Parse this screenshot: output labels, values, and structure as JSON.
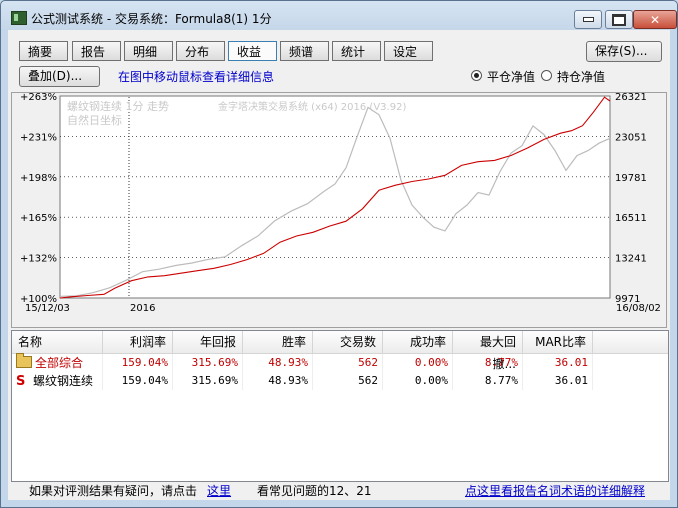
{
  "window": {
    "title": "公式测试系统 - 交易系统：Formula8(1) 1分"
  },
  "toolbar": {
    "tabs": [
      {
        "label": "摘要"
      },
      {
        "label": "报告"
      },
      {
        "label": "明细"
      },
      {
        "label": "分布"
      },
      {
        "label": "收益"
      },
      {
        "label": "频谱"
      },
      {
        "label": "统计"
      },
      {
        "label": "设定"
      }
    ],
    "active_tab": "收益",
    "save_label": "保存(S)...",
    "overlay_label": "叠加(D)...",
    "hint_link": "在图中移动鼠标查看详细信息",
    "radio_flat": "平仓净值",
    "radio_hold": "持仓净值"
  },
  "chart_data": {
    "type": "line",
    "overlay_text": {
      "instrument": "螺纹钢连续 1分 走势",
      "axis_note": "自然日坐标",
      "system_caption": "金字塔决策交易系统 (x64) 2016 (V3.92)"
    },
    "left_ticks": [
      "+263%",
      "+231%",
      "+198%",
      "+165%",
      "+132%",
      "+100%"
    ],
    "right_ticks": [
      "26321",
      "23051",
      "19781",
      "16511",
      "13241",
      "9971"
    ],
    "x_start_label": "15/12/03",
    "x_mid_label": "2016",
    "x_end_label": "16/08/02",
    "ylim_percent": [
      100,
      263
    ],
    "ylim_price": [
      9971,
      26321
    ],
    "series": [
      {
        "name": "平仓净值",
        "color": "#cc0000",
        "x": [
          0,
          0.02,
          0.05,
          0.08,
          0.1,
          0.13,
          0.16,
          0.19,
          0.22,
          0.25,
          0.28,
          0.31,
          0.34,
          0.37,
          0.4,
          0.43,
          0.46,
          0.49,
          0.52,
          0.55,
          0.58,
          0.61,
          0.64,
          0.67,
          0.7,
          0.73,
          0.76,
          0.79,
          0.82,
          0.85,
          0.88,
          0.91,
          0.93,
          0.95,
          0.97,
          0.99,
          1.0
        ],
        "values": [
          100,
          101,
          102,
          103,
          108,
          114,
          117,
          118,
          120,
          122,
          124,
          127,
          131,
          136,
          145,
          150,
          153,
          158,
          162,
          172,
          187,
          191,
          194,
          196,
          199,
          207,
          210,
          211,
          215,
          221,
          228,
          233,
          235,
          239,
          250,
          262,
          259
        ]
      },
      {
        "name": "螺纹钢连续",
        "color": "#bcbcbc",
        "x": [
          0,
          0.03,
          0.06,
          0.09,
          0.12,
          0.15,
          0.18,
          0.21,
          0.24,
          0.27,
          0.3,
          0.33,
          0.36,
          0.39,
          0.42,
          0.45,
          0.48,
          0.5,
          0.52,
          0.54,
          0.56,
          0.58,
          0.6,
          0.62,
          0.64,
          0.66,
          0.68,
          0.7,
          0.72,
          0.74,
          0.76,
          0.78,
          0.8,
          0.82,
          0.84,
          0.86,
          0.88,
          0.9,
          0.92,
          0.94,
          0.96,
          0.98,
          1.0
        ],
        "values": [
          10100,
          10150,
          10400,
          10800,
          11400,
          12100,
          12300,
          12600,
          12800,
          13100,
          13300,
          14200,
          15000,
          16200,
          17000,
          17600,
          18600,
          19200,
          20500,
          23000,
          25400,
          24800,
          22900,
          19500,
          17500,
          16500,
          15700,
          15400,
          16800,
          17500,
          18500,
          18300,
          20200,
          21700,
          22300,
          23900,
          23200,
          21900,
          20300,
          21500,
          21900,
          22500,
          22900
        ]
      }
    ],
    "grid": true,
    "cursor_line_x": "2016"
  },
  "results_table": {
    "columns": [
      "名称",
      "利润率",
      "年回报",
      "胜率",
      "交易数",
      "成功率",
      "最大回撤...",
      "MAR比率"
    ],
    "rows": [
      {
        "icon": "folder-icon",
        "name": "全部综合",
        "cells": [
          "159.04%",
          "315.69%",
          "48.93%",
          "562",
          "0.00%",
          "8.77%",
          "36.01"
        ],
        "color": "#c00000"
      },
      {
        "icon": "s-icon",
        "name": "螺纹钢连续",
        "cells": [
          "159.04%",
          "315.69%",
          "48.93%",
          "562",
          "0.00%",
          "8.77%",
          "36.01"
        ],
        "color": "#000000"
      }
    ]
  },
  "footer": {
    "question_text": "如果对评测结果有疑问，请点击",
    "here_link": "这里",
    "faq_text": "看常见问题的12、21",
    "glossary_link": "点这里看报告名词术语的详细解释"
  }
}
